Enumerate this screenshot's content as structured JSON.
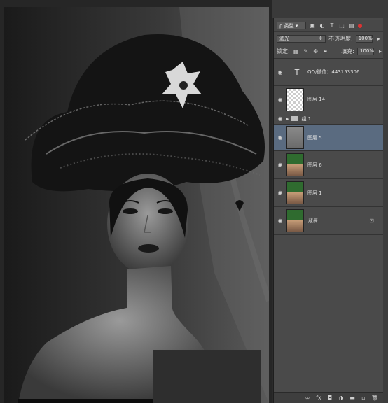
{
  "filter": {
    "label": "类型"
  },
  "blend": {
    "mode": "滤光",
    "opacity_label": "不透明度:",
    "opacity_value": "100%"
  },
  "lock": {
    "label": "锁定:",
    "fill_label": "填充:",
    "fill_value": "100%"
  },
  "layers": [
    {
      "name": "QQ/微信：443153306",
      "kind": "text"
    },
    {
      "name": "图层 14",
      "kind": "transparent"
    },
    {
      "name": "组 1",
      "kind": "group"
    },
    {
      "name": "图层 5",
      "kind": "gray",
      "selected": true
    },
    {
      "name": "图层 6",
      "kind": "photo"
    },
    {
      "name": "图层 1",
      "kind": "photo"
    },
    {
      "name": "背景",
      "kind": "photo",
      "locked": true
    }
  ],
  "colors": {
    "selected": "#5a6b80",
    "panel": "#4a4a4a"
  }
}
